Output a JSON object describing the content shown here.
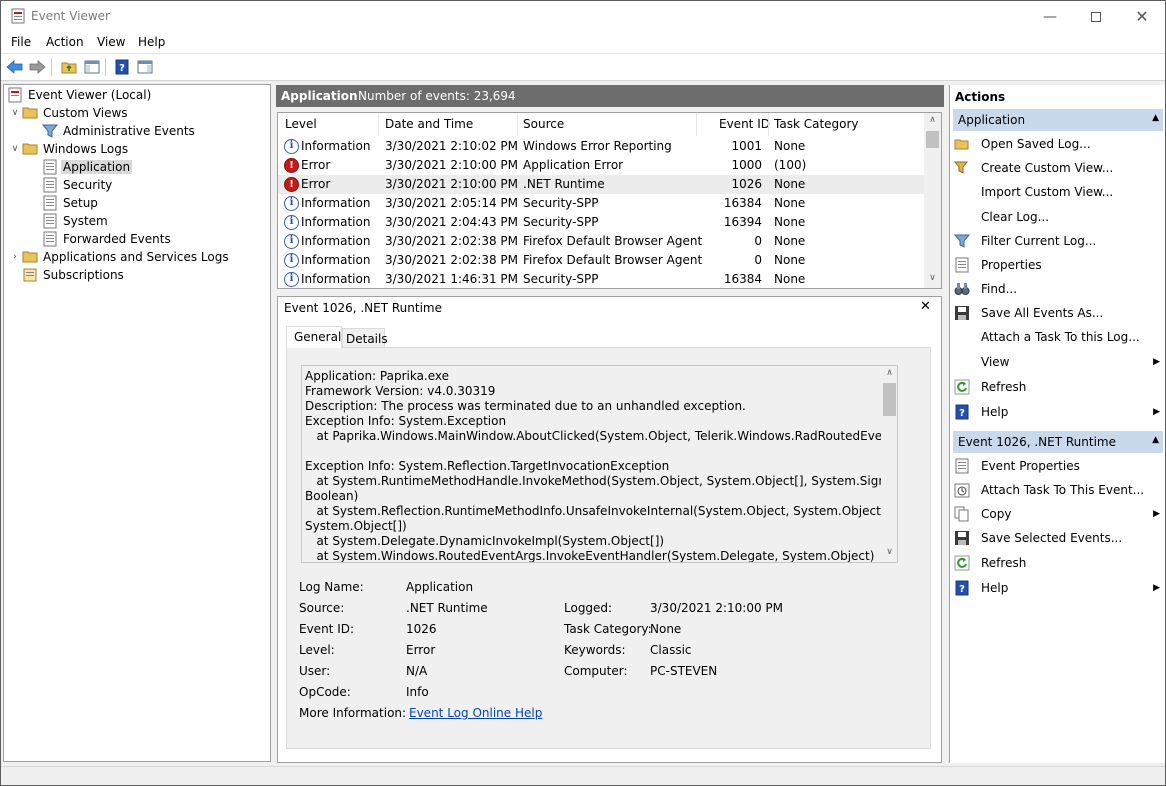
{
  "window": {
    "title": "Event Viewer"
  },
  "menu": [
    "File",
    "Action",
    "View",
    "Help"
  ],
  "tree": {
    "root": "Event Viewer (Local)",
    "custom_views": "Custom Views",
    "admin_events": "Administrative Events",
    "windows_logs": "Windows Logs",
    "application": "Application",
    "security": "Security",
    "setup": "Setup",
    "system": "System",
    "forwarded": "Forwarded Events",
    "apps_services": "Applications and Services Logs",
    "subscriptions": "Subscriptions"
  },
  "center": {
    "log_name": "Application",
    "event_count": "Number of events: 23,694",
    "columns": [
      "Level",
      "Date and Time",
      "Source",
      "Event ID",
      "Task Category"
    ],
    "rows": [
      {
        "level": "Information",
        "icon": "info",
        "date": "3/30/2021 2:10:02 PM",
        "source": "Windows Error Reporting",
        "id": "1001",
        "cat": "None"
      },
      {
        "level": "Error",
        "icon": "error",
        "date": "3/30/2021 2:10:00 PM",
        "source": "Application Error",
        "id": "1000",
        "cat": "(100)"
      },
      {
        "level": "Error",
        "icon": "error",
        "date": "3/30/2021 2:10:00 PM",
        "source": ".NET Runtime",
        "id": "1026",
        "cat": "None"
      },
      {
        "level": "Information",
        "icon": "info",
        "date": "3/30/2021 2:05:14 PM",
        "source": "Security-SPP",
        "id": "16384",
        "cat": "None"
      },
      {
        "level": "Information",
        "icon": "info",
        "date": "3/30/2021 2:04:43 PM",
        "source": "Security-SPP",
        "id": "16394",
        "cat": "None"
      },
      {
        "level": "Information",
        "icon": "info",
        "date": "3/30/2021 2:02:38 PM",
        "source": "Firefox Default Browser Agent",
        "id": "0",
        "cat": "None"
      },
      {
        "level": "Information",
        "icon": "info",
        "date": "3/30/2021 2:02:38 PM",
        "source": "Firefox Default Browser Agent",
        "id": "0",
        "cat": "None"
      },
      {
        "level": "Information",
        "icon": "info",
        "date": "3/30/2021 1:46:31 PM",
        "source": "Security-SPP",
        "id": "16384",
        "cat": "None"
      }
    ]
  },
  "detail": {
    "title": "Event 1026, .NET Runtime",
    "close": "✕",
    "tabs": [
      "General",
      "Details"
    ],
    "description": [
      "Application: Paprika.exe",
      "Framework Version: v4.0.30319",
      "Description: The process was terminated due to an unhandled exception.",
      "Exception Info: System.Exception",
      "   at Paprika.Windows.MainWindow.AboutClicked(System.Object, Telerik.Windows.RadRoutedEventArgs)",
      "",
      "Exception Info: System.Reflection.TargetInvocationException",
      "   at System.RuntimeMethodHandle.InvokeMethod(System.Object, System.Object[], System.Signature,",
      "Boolean)",
      "   at System.Reflection.RuntimeMethodInfo.UnsafeInvokeInternal(System.Object, System.Object[],",
      "System.Object[])",
      "   at System.Delegate.DynamicInvokeImpl(System.Object[])",
      "   at System.Windows.RoutedEventArgs.InvokeEventHandler(System.Delegate, System.Object)"
    ],
    "props": {
      "log_name_label": "Log Name:",
      "log_name": "Application",
      "source_label": "Source:",
      "source": ".NET Runtime",
      "logged_label": "Logged:",
      "logged": "3/30/2021 2:10:00 PM",
      "event_id_label": "Event ID:",
      "event_id": "1026",
      "task_label": "Task Category:",
      "task": "None",
      "level_label": "Level:",
      "level": "Error",
      "keywords_label": "Keywords:",
      "keywords": "Classic",
      "user_label": "User:",
      "user": "N/A",
      "computer_label": "Computer:",
      "computer": "PC-STEVEN",
      "opcode_label": "OpCode:",
      "opcode": "Info",
      "more_info_label": "More Information:",
      "more_info_link": "Event Log Online Help"
    }
  },
  "actions": {
    "header": "Actions",
    "section1": "Application",
    "items1": [
      "Open Saved Log...",
      "Create Custom View...",
      "Import Custom View...",
      "Clear Log...",
      "Filter Current Log...",
      "Properties",
      "Find...",
      "Save All Events As...",
      "Attach a Task To this Log...",
      "View",
      "Refresh",
      "Help"
    ],
    "section2": "Event 1026, .NET Runtime",
    "items2": [
      "Event Properties",
      "Attach Task To This Event...",
      "Copy",
      "Save Selected Events...",
      "Refresh",
      "Help"
    ]
  },
  "colors": {
    "section_bg": "#c9d9ec",
    "header_bg": "#6d6d6d",
    "error": "#c11b1b",
    "info": "#2b4f9e",
    "link": "#0645ad"
  }
}
